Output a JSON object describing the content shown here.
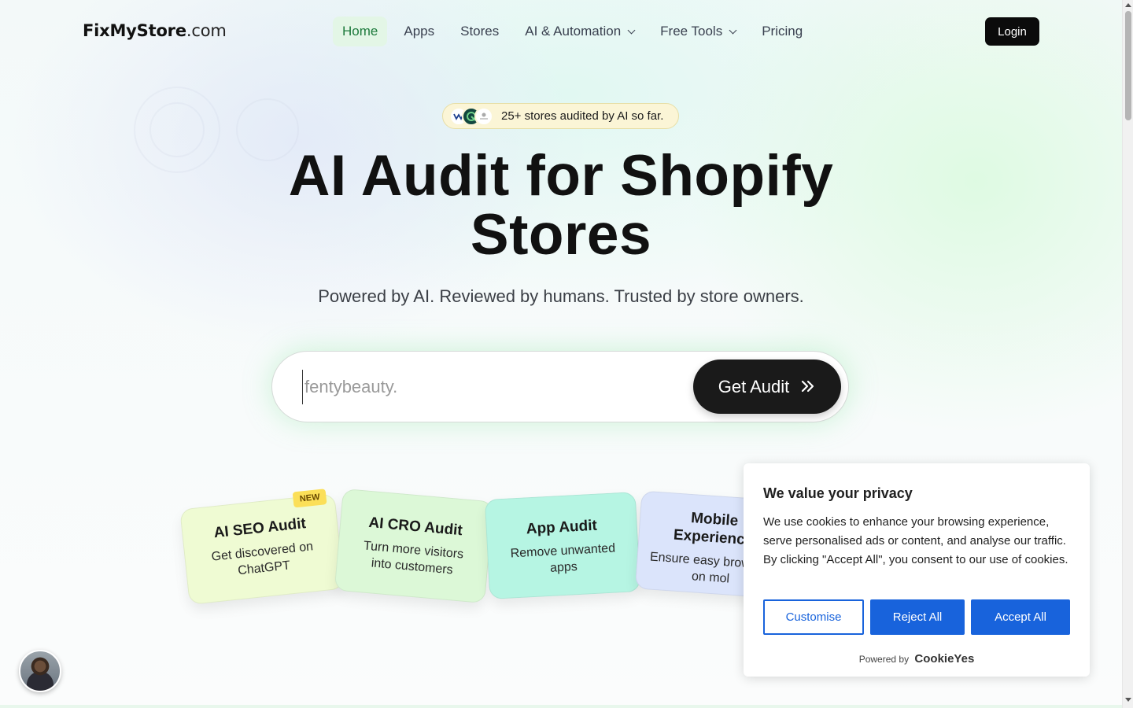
{
  "header": {
    "logo_bold": "FixMyStore",
    "logo_suffix": ".com",
    "nav": [
      {
        "label": "Home",
        "active": true
      },
      {
        "label": "Apps"
      },
      {
        "label": "Stores"
      },
      {
        "label": "AI & Automation",
        "dropdown": true
      },
      {
        "label": "Free Tools",
        "dropdown": true
      },
      {
        "label": "Pricing"
      }
    ],
    "login_label": "Login"
  },
  "badge": {
    "text": "25+ stores audited by AI so far."
  },
  "hero": {
    "title_line1": "AI Audit for Shopify",
    "title_line2": "Stores",
    "subtitle": "Powered by AI. Reviewed by humans. Trusted by store owners."
  },
  "search": {
    "placeholder": "fentybeauty.",
    "button_label": "Get Audit",
    "button_icon": "double-chevron-right-icon"
  },
  "cards": [
    {
      "title": "AI SEO Audit",
      "subtitle": "Get discovered on ChatGPT",
      "tag": "NEW"
    },
    {
      "title": "AI CRO Audit",
      "subtitle": "Turn more visitors into customers"
    },
    {
      "title": "App Audit",
      "subtitle": "Remove unwanted apps"
    },
    {
      "title": "Mobile Experience",
      "subtitle": "Ensure easy browsing on mol"
    }
  ],
  "cookie": {
    "title": "We value your privacy",
    "body": "We use cookies to enhance your browsing experience, serve personalised ads or content, and analyse our traffic. By clicking \"Accept All\", you consent to our use of cookies.",
    "customise_label": "Customise",
    "reject_label": "Reject All",
    "accept_label": "Accept All",
    "powered_by": "Powered by",
    "brand": "CookieYes"
  },
  "colors": {
    "accent_blue": "#1863dc",
    "nav_active_green": "#1d7a3c",
    "dark_button": "#1a1a1a"
  }
}
